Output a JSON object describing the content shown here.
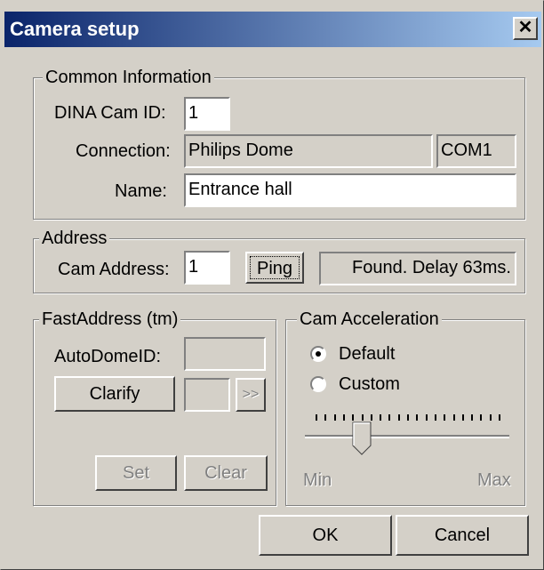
{
  "window": {
    "title": "Camera setup",
    "close_glyph": "✕"
  },
  "common": {
    "group_title": "Common Information",
    "cam_id_label": "DINA Cam ID:",
    "cam_id_value": "1",
    "connection_label": "Connection:",
    "connection_value": "Philips Dome",
    "connection_port": "COM1",
    "name_label": "Name:",
    "name_value": "Entrance hall"
  },
  "address": {
    "group_title": "Address",
    "cam_address_label": "Cam Address:",
    "cam_address_value": "1",
    "ping_label": "Ping",
    "status": "Found. Delay 63ms."
  },
  "fastaddress": {
    "group_title": "FastAddress (tm)",
    "autodome_label": "AutoDomeID:",
    "autodome_value": "",
    "clarify_label": "Clarify",
    "small_value": "",
    "next_label": ">>",
    "set_label": "Set",
    "clear_label": "Clear"
  },
  "acceleration": {
    "group_title": "Cam Acceleration",
    "options": [
      {
        "label": "Default",
        "selected": true
      },
      {
        "label": "Custom",
        "selected": false
      }
    ],
    "min_label": "Min",
    "max_label": "Max",
    "slider_level": 0.25
  },
  "footer": {
    "ok_label": "OK",
    "cancel_label": "Cancel"
  }
}
